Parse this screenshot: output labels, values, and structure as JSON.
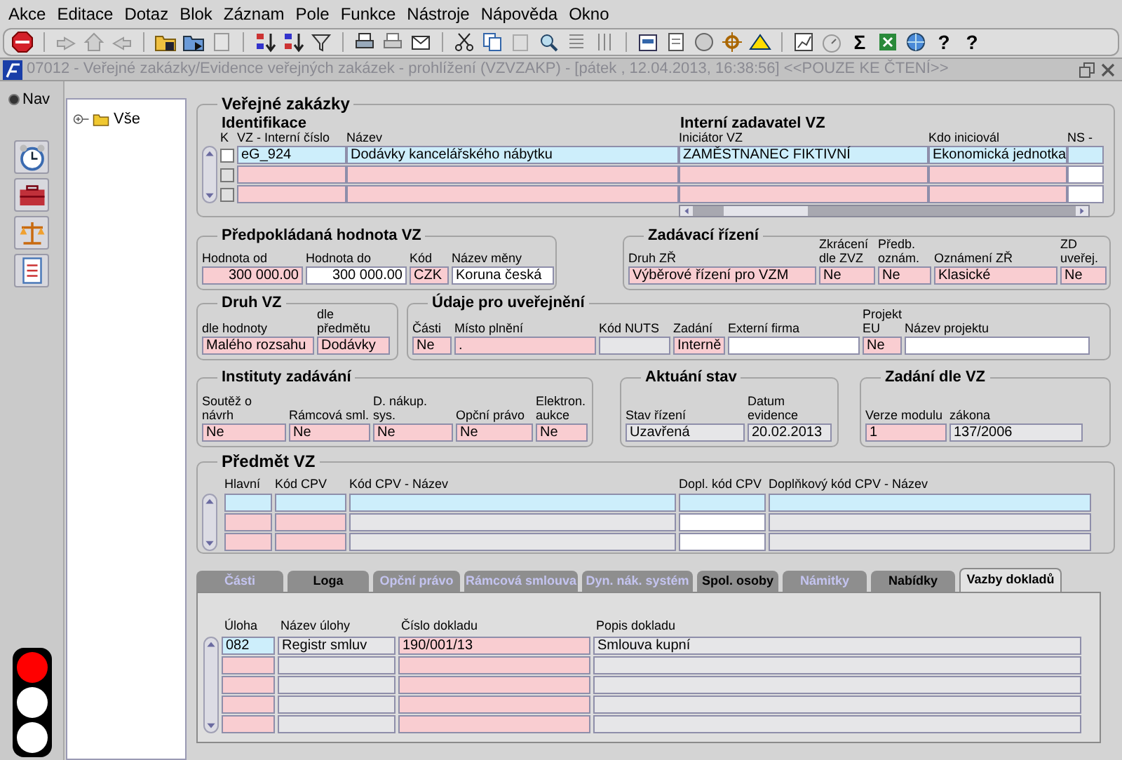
{
  "menu": [
    {
      "label": "Akce"
    },
    {
      "label": "Editace"
    },
    {
      "label": "Dotaz"
    },
    {
      "label": "Blok"
    },
    {
      "label": "Záznam"
    },
    {
      "label": "Pole"
    },
    {
      "label": "Funkce"
    },
    {
      "label": "Nástroje"
    },
    {
      "label": "Nápověda"
    },
    {
      "label": "Okno"
    }
  ],
  "toolbar": {
    "labels": [
      "Σ",
      "?",
      "?"
    ]
  },
  "window": {
    "title": "07012 - Veřejné zakázky/Evidence veřejných zakázek - prohlížení (VZVZAKP) - [pátek , 12.04.2013, 16:38:56] <<POUZE KE ČTENÍ>>"
  },
  "navigator": {
    "label": "Nav",
    "selected": true
  },
  "tree": [
    {
      "label": "Vše",
      "expanded": false
    }
  ],
  "traffic_light": {
    "red": true,
    "yellow": false,
    "green": false
  },
  "contracts": {
    "title": "Veřejné zakázky",
    "groups": [
      "Identifikace",
      "Interní zadavatel VZ"
    ],
    "columns": [
      {
        "label": "K",
        "kind": "checkbox"
      },
      {
        "label": "VZ - Interní číslo",
        "kind": "required"
      },
      {
        "label": "Název",
        "kind": "required"
      },
      {
        "label": "Iniciátor VZ",
        "kind": "required"
      },
      {
        "label": "Kdo iniciovál",
        "kind": "required"
      },
      {
        "label": "NS -",
        "kind": "plain"
      }
    ],
    "rows": [
      {
        "selected": true,
        "checked": false,
        "cells": [
          "eG_924",
          "Dodávky kancelářského nábytku",
          "ZAMĚSTNANEC FIKTIVNÍ",
          "Ekonomická jednotka"
        ]
      },
      {
        "selected": false,
        "checked": false
      },
      {
        "selected": false,
        "checked": false
      }
    ]
  },
  "sections": [
    {
      "title": "Předpokládaná hodnota VZ",
      "fields": [
        {
          "label": "Hodnota od",
          "value": "300 000.00",
          "kind": "required"
        },
        {
          "label": "Hodnota do",
          "value": "300 000.00",
          "kind": "plain"
        },
        {
          "label": "Kód",
          "value": "CZK",
          "kind": "required"
        },
        {
          "label": "Název měny",
          "value": "Koruna česká",
          "kind": "plain"
        }
      ]
    },
    {
      "title": "Zadávací řízení",
      "fields": [
        {
          "label": "Druh ZŘ",
          "value": "Výběrové řízení pro VZM",
          "kind": "required"
        },
        {
          "label": "Zkrácení dle ZVZ",
          "value": "Ne",
          "kind": "required"
        },
        {
          "label": "Předb. oznám.",
          "value": "Ne",
          "kind": "required"
        },
        {
          "label": "Oznámení ZŘ",
          "value": "Klasické",
          "kind": "required"
        },
        {
          "label": "ZD uveřej.",
          "value": "Ne",
          "kind": "required"
        }
      ]
    },
    {
      "title": "Druh VZ",
      "fields": [
        {
          "label": "dle hodnoty",
          "value": "Malého rozsahu",
          "kind": "required"
        },
        {
          "label": "dle předmětu",
          "value": "Dodávky",
          "kind": "required"
        }
      ]
    },
    {
      "title": "Údaje pro uveřejnění",
      "fields": [
        {
          "label": "Části",
          "value": "Ne",
          "kind": "required"
        },
        {
          "label": "Místo plnění",
          "value": ".",
          "kind": "required"
        },
        {
          "label": "Kód NUTS",
          "kind": "readonly"
        },
        {
          "label": "Zadání",
          "value": "Interně",
          "kind": "required"
        },
        {
          "label": "Externí firma",
          "kind": "plain"
        },
        {
          "label": "Projekt EU",
          "value": "Ne",
          "kind": "required"
        },
        {
          "label": "Název projektu",
          "kind": "plain"
        }
      ]
    },
    {
      "title": "Instituty zadávání",
      "fields": [
        {
          "label": "Soutěž o návrh",
          "value": "Ne",
          "kind": "required"
        },
        {
          "label": "Rámcová sml.",
          "value": "Ne",
          "kind": "required"
        },
        {
          "label": "D. nákup. sys.",
          "value": "Ne",
          "kind": "required"
        },
        {
          "label": "Opční právo",
          "value": "Ne",
          "kind": "required"
        },
        {
          "label": "Elektron. aukce",
          "value": "Ne",
          "kind": "required"
        }
      ]
    },
    {
      "title": "Aktuání stav",
      "fields": [
        {
          "label": "Stav řízení",
          "value": "Uzavřená",
          "kind": "readonly"
        },
        {
          "label": "Datum evidence",
          "value": "20.02.2013",
          "kind": "readonly"
        }
      ]
    },
    {
      "title": "Zadání dle VZ",
      "fields": [
        {
          "label": "Verze modulu",
          "value": "1",
          "kind": "required"
        },
        {
          "label": "zákona",
          "value": "137/2006",
          "kind": "readonly"
        }
      ]
    }
  ],
  "subject": {
    "title": "Předmět VZ",
    "columns": [
      {
        "label": "Hlavní",
        "kind": "required"
      },
      {
        "label": "Kód CPV",
        "kind": "required"
      },
      {
        "label": "Kód CPV - Název",
        "kind": "readonly"
      },
      {
        "label": "Dopl. kód CPV",
        "kind": "plain"
      },
      {
        "label": "Doplňkový kód CPV - Název",
        "kind": "readonly"
      }
    ],
    "rows": [
      {
        "selected": true
      },
      {
        "selected": false
      },
      {
        "selected": false
      }
    ]
  },
  "tabs": [
    {
      "label": "Části",
      "selected": false,
      "disabled": true
    },
    {
      "label": "Loga",
      "selected": false,
      "disabled": false
    },
    {
      "label": "Opční právo",
      "selected": false,
      "disabled": true
    },
    {
      "label": "Rámcová smlouva",
      "selected": false,
      "disabled": true
    },
    {
      "label": "Dyn. nák. systém",
      "selected": false,
      "disabled": true
    },
    {
      "label": "Spol. osoby",
      "selected": false,
      "disabled": false
    },
    {
      "label": "Námitky",
      "selected": false,
      "disabled": true
    },
    {
      "label": "Nabídky",
      "selected": false,
      "disabled": false
    },
    {
      "label": "Vazby dokladů",
      "selected": true,
      "disabled": false
    }
  ],
  "documents": {
    "columns": [
      {
        "label": "Úloha",
        "kind": "required"
      },
      {
        "label": "Název úlohy",
        "kind": "readonly"
      },
      {
        "label": "Číslo dokladu",
        "kind": "required"
      },
      {
        "label": "Popis dokladu",
        "kind": "readonly"
      }
    ],
    "rows": [
      {
        "selected": true,
        "cells": [
          "082",
          "Registr smluv",
          "190/001/13",
          "Smlouva kupní"
        ]
      },
      {
        "selected": false
      },
      {
        "selected": false
      },
      {
        "selected": false
      },
      {
        "selected": false
      }
    ]
  }
}
